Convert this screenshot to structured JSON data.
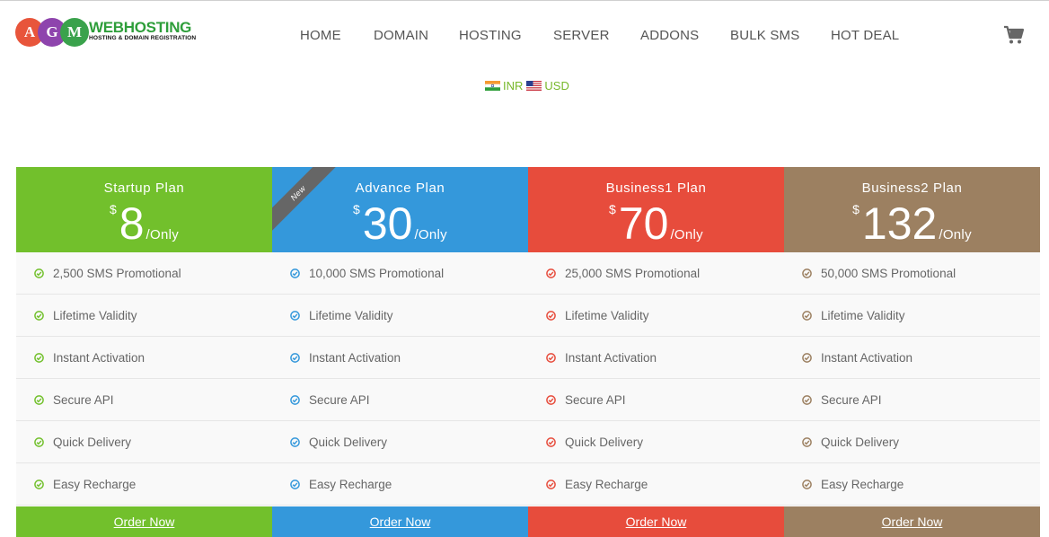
{
  "logo": {
    "letters": [
      "A",
      "G",
      "M"
    ],
    "brand": "WEBHOSTING",
    "tagline": "HOSTING & DOMAIN REGISTRATION"
  },
  "nav": [
    {
      "label": "HOME",
      "name": "nav-home"
    },
    {
      "label": "DOMAIN",
      "name": "nav-domain"
    },
    {
      "label": "HOSTING",
      "name": "nav-hosting"
    },
    {
      "label": "SERVER",
      "name": "nav-server"
    },
    {
      "label": "ADDONS",
      "name": "nav-addons"
    },
    {
      "label": "BULK SMS",
      "name": "nav-bulk-sms"
    },
    {
      "label": "HOT DEAL",
      "name": "nav-hot-deal"
    }
  ],
  "cart_icon": "shopping-cart-icon",
  "currency": {
    "inr": "INR",
    "usd": "USD"
  },
  "plans": [
    {
      "name": "Startup Plan",
      "symbol": "$",
      "price": "8",
      "suffix": "/Only",
      "color": "#72c02c",
      "features": [
        "2,500 SMS Promotional",
        "Lifetime Validity",
        "Instant Activation",
        "Secure API",
        "Quick Delivery",
        "Easy Recharge"
      ],
      "button": "Order Now"
    },
    {
      "name": "Advance Plan",
      "symbol": "$",
      "price": "30",
      "suffix": "/Only",
      "color": "#3498db",
      "ribbon": "New",
      "features": [
        "10,000 SMS Promotional",
        "Lifetime Validity",
        "Instant Activation",
        "Secure API",
        "Quick Delivery",
        "Easy Recharge"
      ],
      "button": "Order Now"
    },
    {
      "name": "Business1 Plan",
      "symbol": "$",
      "price": "70",
      "suffix": "/Only",
      "color": "#e74c3c",
      "features": [
        "25,000 SMS Promotional",
        "Lifetime Validity",
        "Instant Activation",
        "Secure API",
        "Quick Delivery",
        "Easy Recharge"
      ],
      "button": "Order Now"
    },
    {
      "name": "Business2 Plan",
      "symbol": "$",
      "price": "132",
      "suffix": "/Only",
      "color": "#9c8061",
      "features": [
        "50,000 SMS Promotional",
        "Lifetime Validity",
        "Instant Activation",
        "Secure API",
        "Quick Delivery",
        "Easy Recharge"
      ],
      "button": "Order Now"
    }
  ]
}
